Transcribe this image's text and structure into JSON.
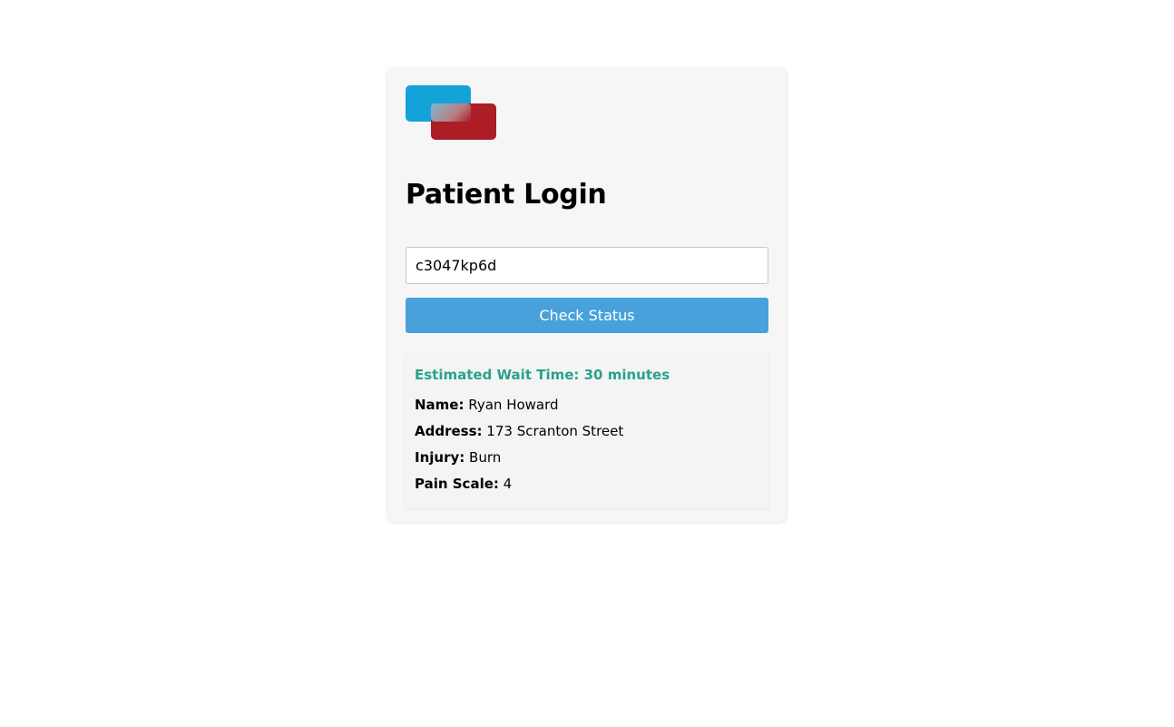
{
  "login": {
    "title": "Patient Login",
    "patient_code": "c3047kp6d",
    "check_button_label": "Check Status"
  },
  "status": {
    "wait_label": "Estimated Wait Time:",
    "wait_value": "30 minutes",
    "name_label": "Name:",
    "name_value": "Ryan Howard",
    "address_label": "Address:",
    "address_value": "173 Scranton Street",
    "injury_label": "Injury:",
    "injury_value": "Burn",
    "pain_label": "Pain Scale:",
    "pain_value": "4"
  },
  "colors": {
    "logo_blue": "#13a3d9",
    "logo_red": "#ac1d26",
    "button": "#48a1da",
    "wait_text": "#27a28d"
  }
}
